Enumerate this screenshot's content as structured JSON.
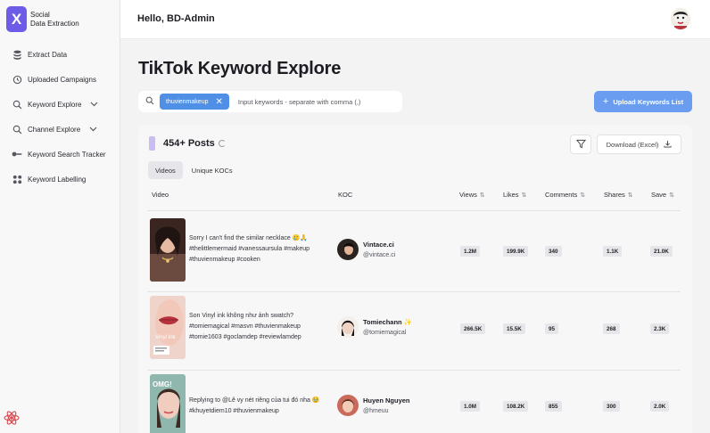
{
  "app": {
    "logo_letter": "X",
    "name_line1": "Social",
    "name_line2": "Data Extraction"
  },
  "sidebar": {
    "items": [
      {
        "label": "Extract Data",
        "icon": "database-icon",
        "chevron": false
      },
      {
        "label": "Uploaded Campaigns",
        "icon": "history-icon",
        "chevron": false
      },
      {
        "label": "Keyword Explore",
        "icon": "search-icon",
        "chevron": true
      },
      {
        "label": "Channel Explore",
        "icon": "search-icon",
        "chevron": true
      },
      {
        "label": "Keyword Search Tracker",
        "icon": "tracker-icon",
        "chevron": false
      },
      {
        "label": "Keyword Labelling",
        "icon": "grid-dots-icon",
        "chevron": false
      }
    ]
  },
  "header": {
    "greeting": "Hello, BD-Admin"
  },
  "page": {
    "title": "TikTok Keyword Explore"
  },
  "search": {
    "chip": "thuvienmakeup",
    "placeholder": "Input keywords - separate with comma (,)"
  },
  "upload_button": "Upload Keywords List",
  "results": {
    "count_label": "454+ Posts",
    "download_label": "Download (Excel)",
    "tabs": [
      "Videos",
      "Unique KOCs"
    ],
    "active_tab": 0,
    "columns": {
      "video": "Video",
      "koc": "KOC",
      "views": "Views",
      "likes": "Likes",
      "comments": "Comments",
      "shares": "Shares",
      "save": "Save"
    },
    "rows": [
      {
        "caption": "Sorry I can't find the similar necklace 🥲🙏 #thelittlemermaid #vanessaursula #makeup #thuvienmakeup #cooken",
        "koc_name": "Vintace.ci",
        "koc_handle": "@vintace.ci",
        "views": "1.2M",
        "likes": "199.9K",
        "comments": "340",
        "shares": "1.1K",
        "save": "21.0K"
      },
      {
        "caption": "Son Vinyl ink không như ảnh swatch? #tomiemagical #masvn #thuvienmakeup #tomie1603 #goclamdep #reviewlamdep",
        "koc_name": "Tomiechann ✨",
        "koc_handle": "@tomiemagical",
        "views": "266.5K",
        "likes": "15.5K",
        "comments": "95",
        "shares": "268",
        "save": "2.3K"
      },
      {
        "caption": "Replying to @Lê vy nét riêng của tui đó nha 🥹 #khuyetdiem10 #thuvienmakeup",
        "koc_name": "Huyen Nguyen",
        "koc_handle": "@hmeuu",
        "views": "1.0M",
        "likes": "108.2K",
        "comments": "855",
        "shares": "300",
        "save": "2.0K"
      }
    ]
  },
  "colors": {
    "brand": "#6d5ce8",
    "chip": "#4f8fe6",
    "upload": "#6a9cf0",
    "posts_bar": "#c9bdf4"
  }
}
